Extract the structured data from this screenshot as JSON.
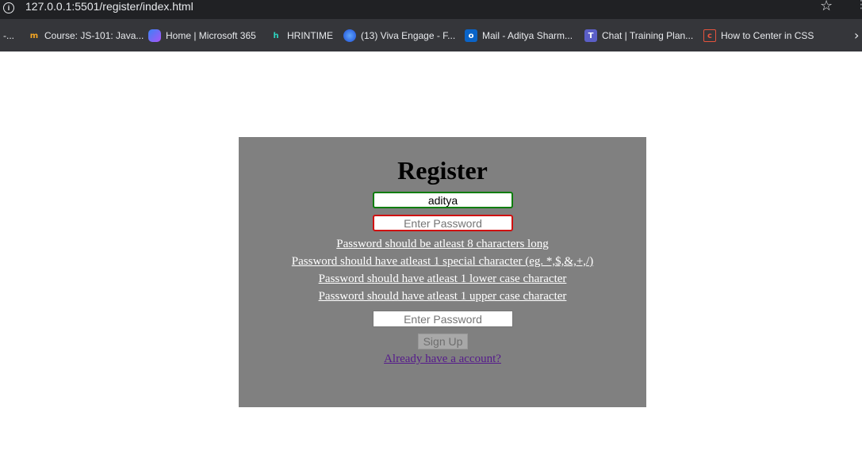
{
  "browser": {
    "url": "127.0.0.1:5501/register/index.html",
    "bookmarks": [
      {
        "label": "-...",
        "icon": "ellipsis-icon"
      },
      {
        "label": "Course: JS-101: Java...",
        "icon": "course-icon"
      },
      {
        "label": "Home | Microsoft 365",
        "icon": "microsoft365-icon"
      },
      {
        "label": "HRINTIME",
        "icon": "hrintime-icon"
      },
      {
        "label": "(13) Viva Engage - F...",
        "icon": "viva-engage-icon"
      },
      {
        "label": "Mail - Aditya Sharm...",
        "icon": "outlook-icon"
      },
      {
        "label": "Chat | Training Plan...",
        "icon": "teams-icon"
      },
      {
        "label": "How to Center in CSS",
        "icon": "css-icon"
      }
    ]
  },
  "register": {
    "title": "Register",
    "username_value": "aditya",
    "password_placeholder": "Enter Password",
    "password_value": "",
    "confirm_placeholder": "Enter Password",
    "confirm_value": "",
    "rules": [
      "Password should be atleast 8 characters long",
      "Password should have atleast 1 special character (eg. *,$,&,+,/)",
      "Password should have atleast 1 lower case character",
      "Password should have atleast 1 upper case character"
    ],
    "signup_label": "Sign Up",
    "login_link": "Already have a account?"
  },
  "colors": {
    "panel": "#808080",
    "valid_border": "#0a7d0a",
    "invalid_border": "#d01010",
    "visited_link": "#551a8b"
  }
}
